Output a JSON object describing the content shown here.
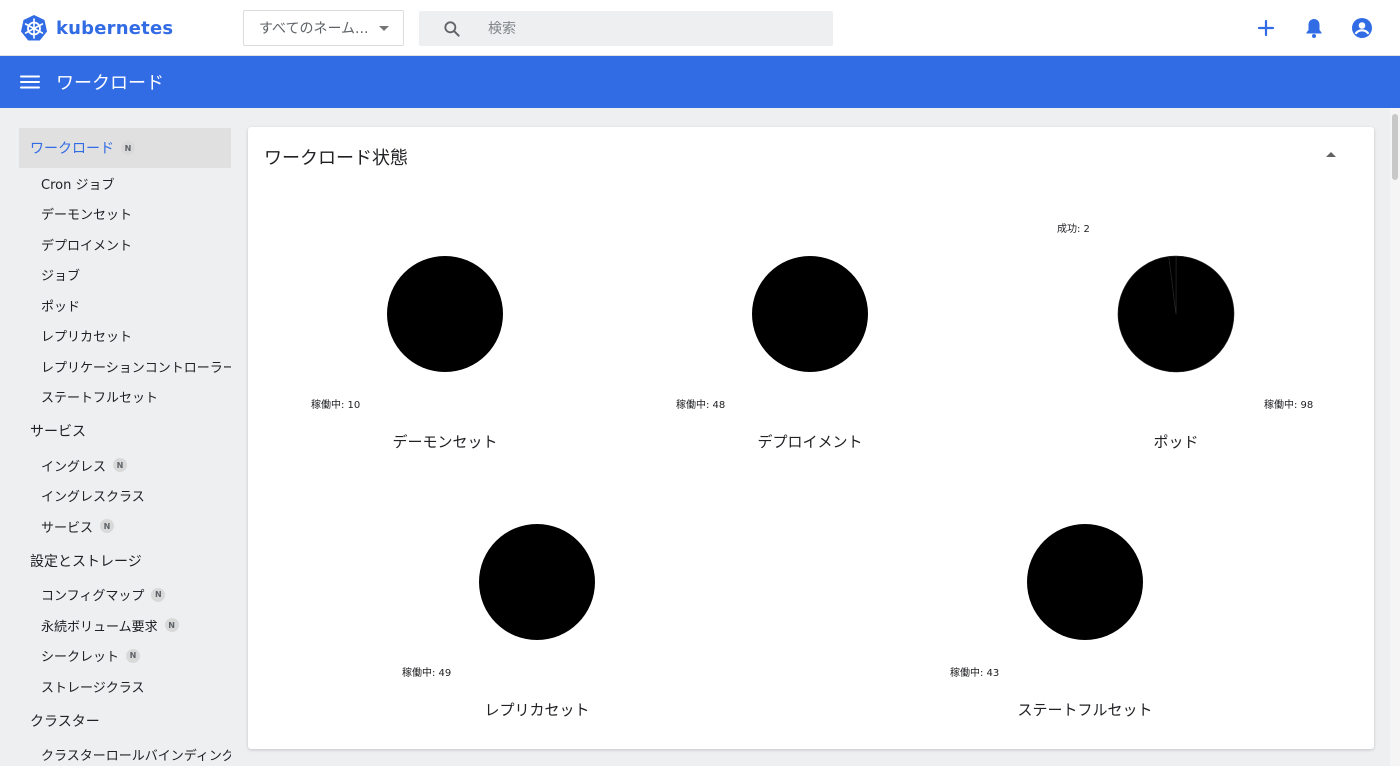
{
  "brand": {
    "name": "kubernetes"
  },
  "header": {
    "namespace_select": "すべてのネーム...",
    "search_placeholder": "検索"
  },
  "appbar": {
    "title": "ワークロード"
  },
  "sidebar": {
    "workloads": {
      "label": "ワークロード",
      "badge": "N"
    },
    "workload_items": [
      {
        "label": "Cron ジョブ"
      },
      {
        "label": "デーモンセット"
      },
      {
        "label": "デプロイメント"
      },
      {
        "label": "ジョブ"
      },
      {
        "label": "ポッド"
      },
      {
        "label": "レプリカセット"
      },
      {
        "label": "レプリケーションコントローラー"
      },
      {
        "label": "ステートフルセット"
      }
    ],
    "services": {
      "label": "サービス"
    },
    "service_items": [
      {
        "label": "イングレス",
        "badge": "N"
      },
      {
        "label": "イングレスクラス"
      },
      {
        "label": "サービス",
        "badge": "N"
      }
    ],
    "config": {
      "label": "設定とストレージ"
    },
    "config_items": [
      {
        "label": "コンフィグマップ",
        "badge": "N"
      },
      {
        "label": "永続ボリューム要求",
        "badge": "N"
      },
      {
        "label": "シークレット",
        "badge": "N"
      },
      {
        "label": "ストレージクラス"
      }
    ],
    "cluster": {
      "label": "クラスター"
    },
    "cluster_items": [
      {
        "label": "クラスターロールバインディング"
      }
    ]
  },
  "card": {
    "title": "ワークロード状態"
  },
  "chart_data": [
    {
      "type": "pie",
      "title": "デーモンセット",
      "slices": [
        {
          "label": "稼働中",
          "value": 10,
          "color": "#000000"
        }
      ]
    },
    {
      "type": "pie",
      "title": "デプロイメント",
      "slices": [
        {
          "label": "稼働中",
          "value": 48,
          "color": "#000000"
        }
      ]
    },
    {
      "type": "pie",
      "title": "ポッド",
      "slices": [
        {
          "label": "稼働中",
          "value": 98,
          "color": "#000000"
        },
        {
          "label": "成功",
          "value": 2,
          "color": "#000000"
        }
      ]
    },
    {
      "type": "pie",
      "title": "レプリカセット",
      "slices": [
        {
          "label": "稼働中",
          "value": 49,
          "color": "#000000"
        }
      ]
    },
    {
      "type": "pie",
      "title": "ステートフルセット",
      "slices": [
        {
          "label": "稼働中",
          "value": 43,
          "color": "#000000"
        }
      ]
    }
  ],
  "colors": {
    "primary": "#326ce5",
    "background": "#eeeff1",
    "text": "#202124"
  },
  "icons": {
    "logo": "kubernetes-helm-icon",
    "search": "search-icon",
    "add": "plus-icon",
    "notifications": "bell-icon",
    "account": "account-circle-icon",
    "menu": "hamburger-menu-icon",
    "collapse": "caret-up-icon"
  }
}
